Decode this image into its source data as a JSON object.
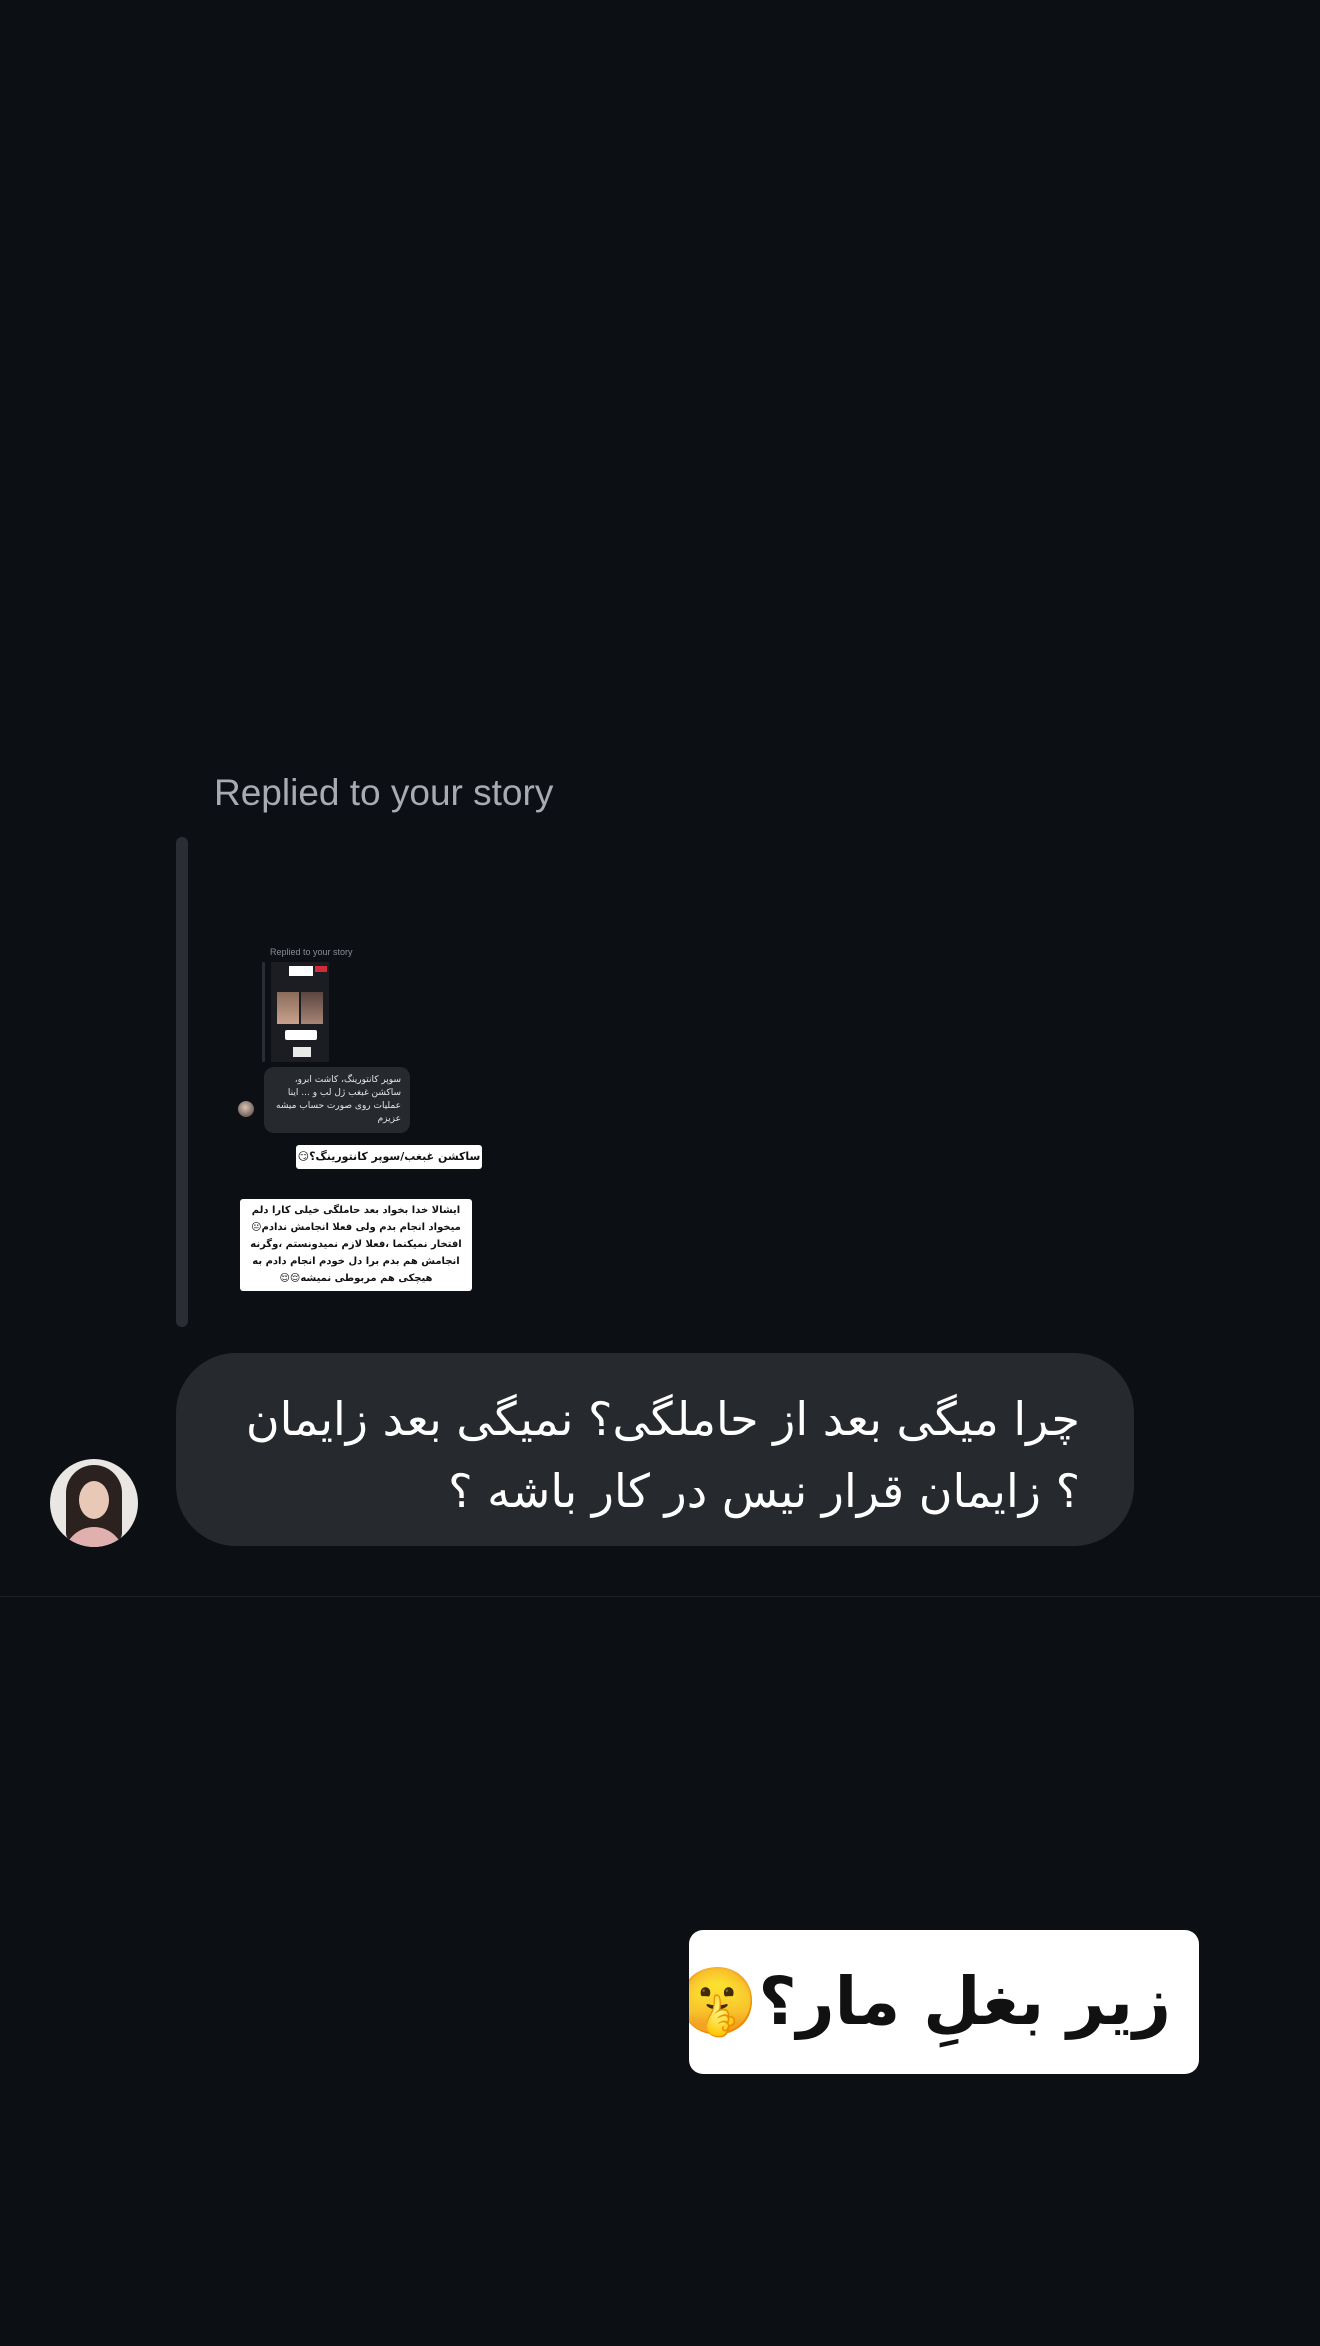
{
  "reply_header": "Replied to your story",
  "story_preview": {
    "header": "Replied to your story",
    "bubble_text": "سوپر کانتورینگ، کاشت ابرو، ساکشن غبغب ژل لب و ... اینا عملیات روی صورت حساب میشه عزیزم",
    "sticker_1": "ساکشن غبغب/سوپر کانتورینگ؟😏",
    "sticker_2": "ایشالا خدا بخواد بعد حاملگی خیلی کارا دلم میخواد انجام بدم ولی فعلا انجامش ندادم😐 افتخار نمیکنما ،فعلا لازم نمیدونستم ،وگرنه انجامش هم بدم برا دل خودم انجام دادم به هیچکی هم مربوطی نمیشه😌😌"
  },
  "message": {
    "text": "چرا میگی بعد از حاملگی؟ نمیگی بعد زایمان ؟ زایمان قرار نیس در کار باشه ؟",
    "sender_avatar": "avatar"
  },
  "sticker": {
    "text": "زیر بغلِ مار؟🤫🤪"
  },
  "colors": {
    "background": "#0c0f14",
    "bubble": "#26292e",
    "muted_text": "#a8abb3"
  }
}
